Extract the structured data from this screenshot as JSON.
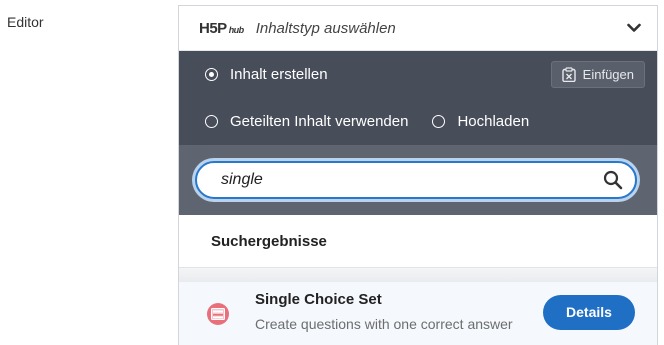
{
  "field": {
    "label": "Editor"
  },
  "hub": {
    "logo_main": "H5P",
    "logo_sub": "hub",
    "header_title": "Inhaltstyp auswählen",
    "options": {
      "create": "Inhalt erstellen",
      "shared": "Geteilten Inhalt verwenden",
      "upload": "Hochladen",
      "selected": "create",
      "paste_label": "Einfügen"
    },
    "search": {
      "value": "single"
    },
    "results_title": "Suchergebnisse",
    "results": [
      {
        "title": "Single Choice Set",
        "description": "Create questions with one correct answer",
        "button": "Details",
        "icon": "single-choice-set-icon"
      }
    ]
  },
  "colors": {
    "options_bg": "#474d59",
    "search_bg": "#5f6570",
    "accent": "#1f6fc5",
    "result_icon": "#e8707a"
  }
}
